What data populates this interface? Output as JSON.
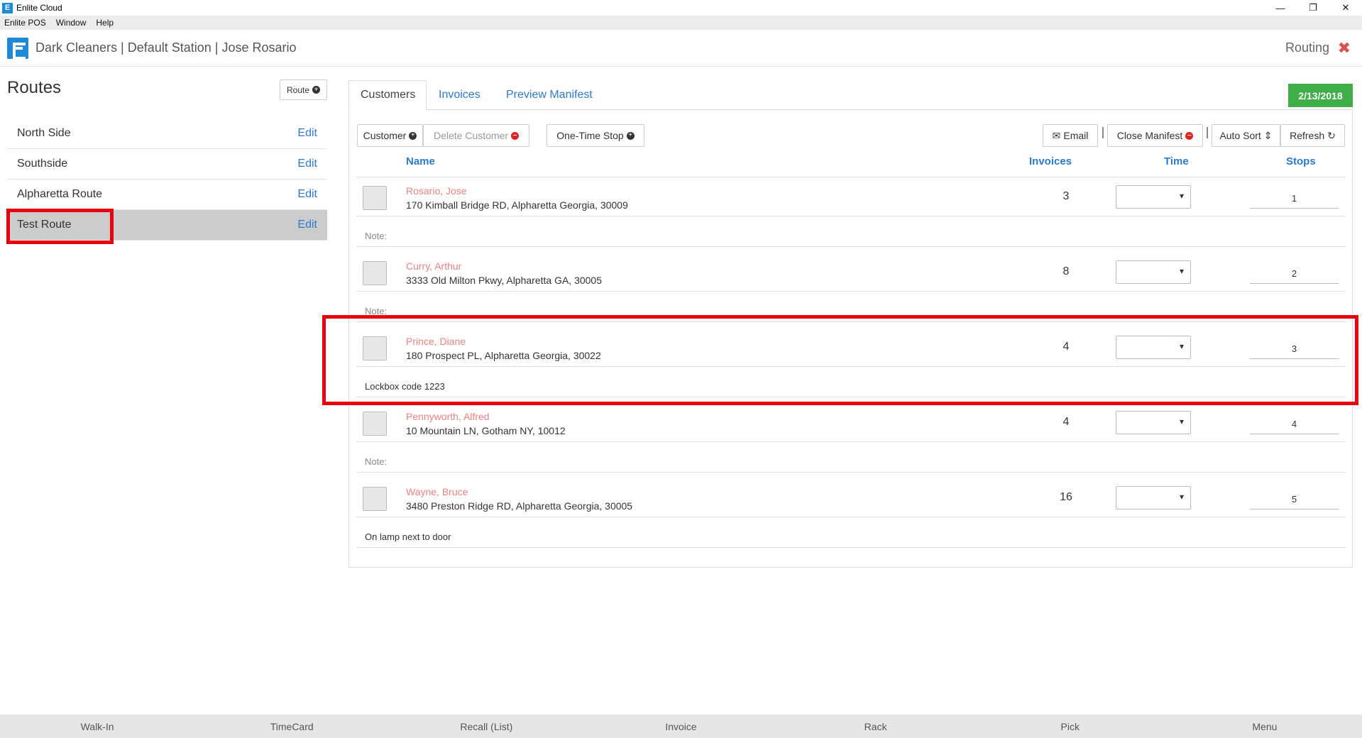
{
  "window": {
    "title": "Enlite Cloud",
    "app_icon_letter": "E"
  },
  "menubar": [
    "Enlite POS",
    "Window",
    "Help"
  ],
  "header": {
    "store": "Dark Cleaners | Default Station | Jose Rosario",
    "module": "Routing"
  },
  "routes": {
    "title": "Routes",
    "add_label": "Route",
    "items": [
      {
        "name": "North Side",
        "edit": "Edit"
      },
      {
        "name": "Southside",
        "edit": "Edit"
      },
      {
        "name": "Alpharetta Route",
        "edit": "Edit"
      },
      {
        "name": "Test Route",
        "edit": "Edit",
        "selected": true
      }
    ]
  },
  "tabs": [
    {
      "label": "Customers",
      "active": true
    },
    {
      "label": "Invoices"
    },
    {
      "label": "Preview Manifest"
    }
  ],
  "date": "2/13/2018",
  "toolbar": {
    "customer": "Customer",
    "delete_customer": "Delete Customer",
    "one_time_stop": "One-Time Stop",
    "email": "Email",
    "close_manifest": "Close Manifest",
    "auto_sort": "Auto Sort",
    "refresh": "Refresh"
  },
  "columns": {
    "name": "Name",
    "invoices": "Invoices",
    "time": "Time",
    "stops": "Stops"
  },
  "customers": [
    {
      "name": "Rosario, Jose",
      "address": "170 Kimball Bridge RD, Alpharetta Georgia, 30009",
      "invoices": "3",
      "stop": "1",
      "note": "Note:"
    },
    {
      "name": "Curry, Arthur",
      "address": "3333 Old Milton Pkwy, Alpharetta GA, 30005",
      "invoices": "8",
      "stop": "2",
      "note": "Note:"
    },
    {
      "name": "Prince, Diane",
      "address": "180 Prospect PL, Alpharetta Georgia, 30022",
      "invoices": "4",
      "stop": "3",
      "note": "Lockbox code 1223"
    },
    {
      "name": "Pennyworth, Alfred",
      "address": "10 Mountain LN, Gotham NY, 10012",
      "invoices": "4",
      "stop": "4",
      "note": "Note:"
    },
    {
      "name": "Wayne, Bruce",
      "address": "3480 Preston Ridge RD, Alpharetta Georgia, 30005",
      "invoices": "16",
      "stop": "5",
      "note": "On lamp next to door"
    }
  ],
  "bottom_nav": [
    "Walk-In",
    "TimeCard",
    "Recall (List)",
    "Invoice",
    "Rack",
    "Pick",
    "Menu"
  ],
  "colors": {
    "accent": "#2a7bd0",
    "brand": "#1c8ad6",
    "date_badge": "#3fae49",
    "customer_name": "#f08080",
    "highlight": "#e8000f"
  }
}
